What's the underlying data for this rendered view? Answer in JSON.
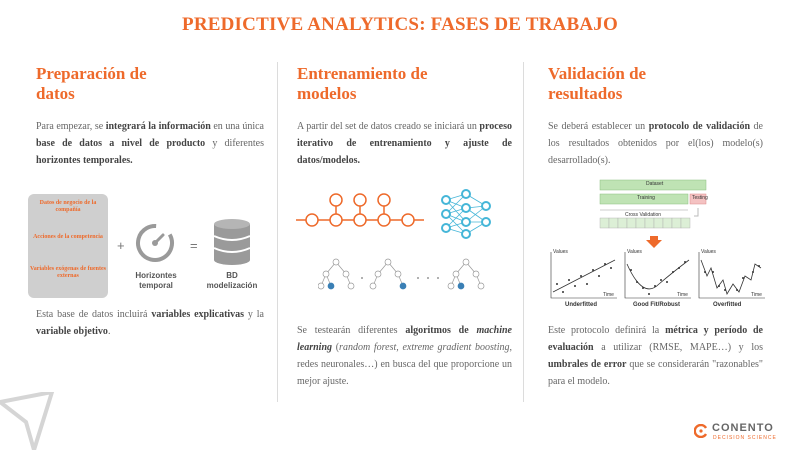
{
  "title": "PREDICTIVE ANALYTICS: FASES DE TRABAJO",
  "col1": {
    "heading_line1": "Preparación de",
    "heading_line2": "datos",
    "p1": "Para empezar, se <b>integrará la información</b> en una única <b>base de datos a nivel de producto</b> y diferentes <b>horizontes temporales.</b>",
    "sources": [
      "Datos de negocio de la compañía",
      "Acciones de la competencia",
      "Variables exógenas de fuentes externas"
    ],
    "plus": "+",
    "equals": "=",
    "horizon_label": "Horizontes temporal",
    "bd_label": "BD modelización",
    "p2": "Esta base de datos incluirá <b>variables explicativas</b> y la <b>variable objetivo</b>."
  },
  "col2": {
    "heading_line1": "Entrenamiento de",
    "heading_line2": "modelos",
    "p1": "A partir del set de datos creado se iniciará un <b>proceso iterativo de entrenamiento y ajuste de datos/modelos.</b>",
    "p2": "Se testearán diferentes <b>algoritmos de <i>machine learning</i></b> (<i>random forest, extreme gradient boosting</i>, redes neuronales…) en busca del que proporcione un mejor ajuste."
  },
  "col3": {
    "heading_line1": "Validación de",
    "heading_line2": "resultados",
    "p1": "Se deberá establecer un <b>protocolo de validación</b> de los resultados obtenidos por el(los) modelo(s) desarrollado(s).",
    "split_labels": {
      "dataset": "Dataset",
      "training": "Training",
      "testing": "Testing",
      "cv": "Cross Validation"
    },
    "plot_labels": {
      "values": "Values",
      "time": "Time"
    },
    "fits": [
      "Underfitted",
      "Good Fit/Robust",
      "Overfitted"
    ],
    "p2": "Este protocolo definirá la <b>métrica y período de evaluación</b> a utilizar (RMSE, MAPE…) y los <b>umbrales de error</b> que se considerarán \"razonables\" para el modelo."
  },
  "logo": {
    "name": "CONENTO",
    "sub": "DECISION SCIENCE"
  },
  "colors": {
    "accent": "#ee6a2b",
    "text": "#666666",
    "grey_box": "#cfcfcf",
    "network_blue": "#45b6d8",
    "green": "#bfe3b4"
  }
}
